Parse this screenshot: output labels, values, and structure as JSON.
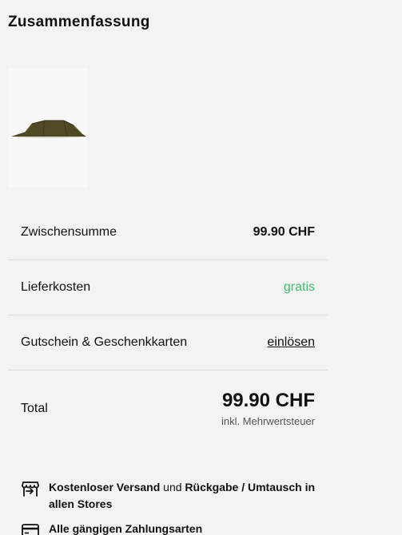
{
  "heading": "Zusammenfassung",
  "product": {
    "image_icon": "tent-product-image"
  },
  "summary": {
    "subtotal_label": "Zwischensumme",
    "subtotal_value": "99.90 CHF",
    "shipping_label": "Lieferkosten",
    "shipping_value": "gratis",
    "voucher_label": "Gutschein & Geschenkkarten",
    "voucher_link": "einlösen",
    "total_label": "Total",
    "total_value": "99.90 CHF",
    "total_note": "inkl. Mehrwertsteuer"
  },
  "benefits": {
    "shipping_bold1": "Kostenloser Versand",
    "shipping_mid": "und",
    "shipping_bold2": "Rückgabe / Umtausch in allen Stores",
    "payment_bold": "Alle gängigen Zahlungsarten",
    "shipping_icon": "store-return-icon",
    "payment_icon": "credit-card-icon"
  },
  "colors": {
    "background": "#f3f3f3",
    "free_shipping": "#3fbf6a",
    "divider": "#dcdcdc"
  }
}
